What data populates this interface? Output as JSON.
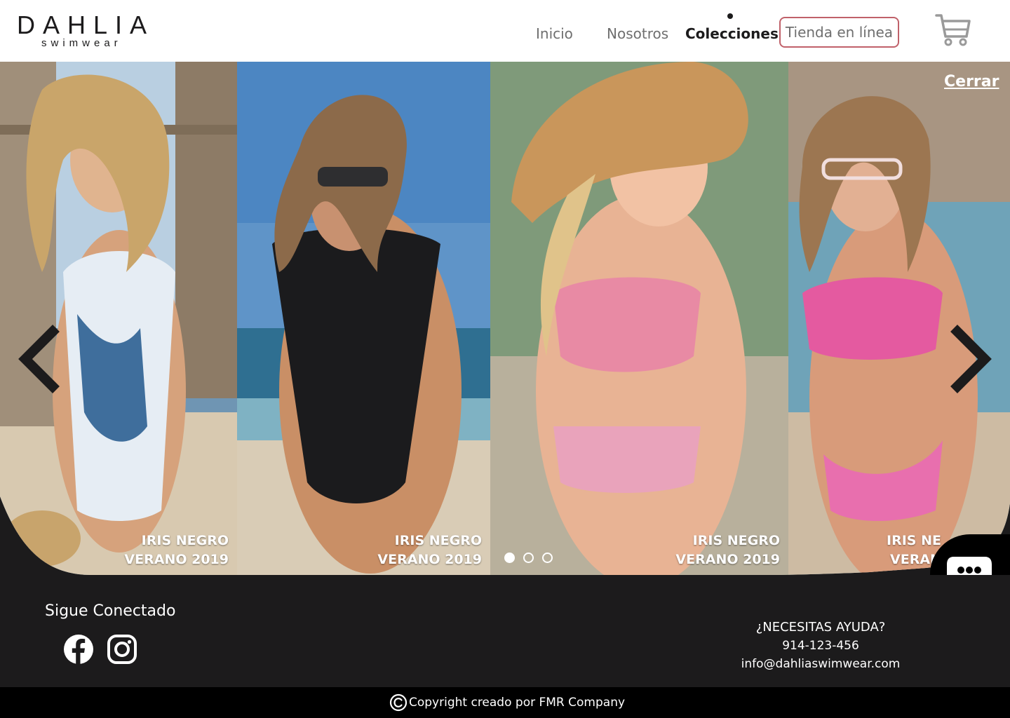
{
  "brand": {
    "name": "DAHLIA",
    "tagline": "swimwear"
  },
  "nav": {
    "items": [
      {
        "label": "Inicio"
      },
      {
        "label": "Nosotros"
      },
      {
        "label": "Colecciones",
        "active": true
      }
    ],
    "shop_button": "Tienda en línea",
    "cart_icon": "cart-icon"
  },
  "carousel": {
    "close_label": "Cerrar",
    "slides": [
      {
        "line1": "IRIS NEGRO",
        "line2": "VERANO 2019"
      },
      {
        "line1": "IRIS NEGRO",
        "line2": "VERANO 2019"
      },
      {
        "line1": "IRIS NEGRO",
        "line2": "VERANO 2019"
      },
      {
        "line1": "IRIS NE",
        "line2": "VERAN"
      }
    ],
    "pagination": {
      "count": 3,
      "active_index": 0
    },
    "prev_icon": "chevron-left-icon",
    "next_icon": "chevron-right-icon"
  },
  "chat": {
    "icon": "chat-bubble-icon"
  },
  "footer": {
    "connect_title": "Sigue Conectado",
    "social": [
      "facebook-icon",
      "instagram-icon"
    ],
    "help": {
      "title": "¿NECESITAS AYUDA?",
      "phone": "914-123-456",
      "email": "info@dahliaswimwear.com"
    },
    "copyright_text": "Copyright creado por FMR Company"
  },
  "colors": {
    "dark": "#1c1b1c",
    "accent_border": "#c0616a",
    "nav_text": "#6f6f6f",
    "white": "#ffffff"
  }
}
